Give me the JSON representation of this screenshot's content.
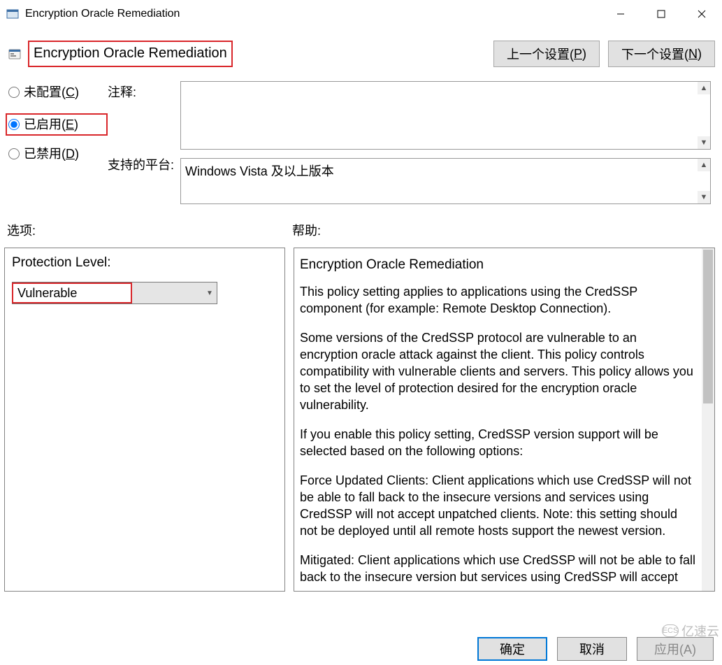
{
  "window": {
    "title": "Encryption Oracle Remediation"
  },
  "header": {
    "policy_title": "Encryption Oracle Remediation",
    "prev_label_pre": "上一个设置(",
    "prev_hotkey": "P",
    "prev_label_post": ")",
    "next_label_pre": "下一个设置(",
    "next_hotkey": "N",
    "next_label_post": ")"
  },
  "state_radios": {
    "not_configured_pre": "未配置(",
    "not_configured_key": "C",
    "not_configured_post": ")",
    "enabled_pre": "已启用(",
    "enabled_key": "E",
    "enabled_post": ")",
    "disabled_pre": "已禁用(",
    "disabled_key": "D",
    "disabled_post": ")",
    "selected": "enabled"
  },
  "labels": {
    "comment": "注释:",
    "platform": "支持的平台:",
    "options": "选项:",
    "help": "帮助:"
  },
  "fields": {
    "comment": "",
    "platform": "Windows Vista 及以上版本"
  },
  "options": {
    "protection_level_label": "Protection Level:",
    "protection_level_value": "Vulnerable"
  },
  "help": {
    "title": "Encryption Oracle Remediation",
    "p1": "This policy setting applies to applications using the CredSSP component (for example: Remote Desktop Connection).",
    "p2": "Some versions of the CredSSP protocol are vulnerable to an encryption oracle attack against the client.  This policy controls compatibility with vulnerable clients and servers.  This policy allows you to set the level of protection desired for the encryption oracle vulnerability.",
    "p3": "If you enable this policy setting, CredSSP version support will be selected based on the following options:",
    "p4": "Force Updated Clients: Client applications which use CredSSP will not be able to fall back to the insecure versions and services using CredSSP will not accept unpatched clients. Note: this setting should not be deployed until all remote hosts support the newest version.",
    "p5": "Mitigated: Client applications which use CredSSP will not be able to fall back to the insecure version but services using CredSSP will accept"
  },
  "buttons": {
    "ok": "确定",
    "cancel": "取消",
    "apply": "应用(A)"
  },
  "watermark": "亿速云"
}
